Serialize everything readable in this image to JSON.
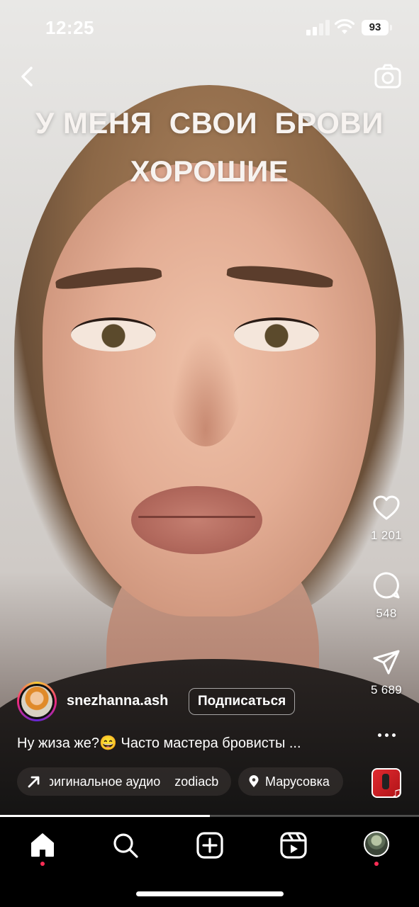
{
  "status_bar": {
    "time": "12:25",
    "battery": "93"
  },
  "overlay_text": {
    "line1": "У МЕНЯ  СВОИ  БРОВИ",
    "line2": "ХОРОШИЕ"
  },
  "actions": {
    "likes": "1 201",
    "comments": "548",
    "shares": "5 689"
  },
  "author": {
    "username": "snezhanna.ash",
    "follow_label": "Подписаться"
  },
  "caption": "Ну жиза же?😄 Часто мастера бровисты ...",
  "audio_chip": {
    "text": "Оригинальное аудио    zodiacb"
  },
  "location_chip": {
    "text": "Марусовка"
  },
  "playback": {
    "progress_fraction": 0.5
  },
  "tabs": [
    "home",
    "search",
    "create",
    "reels",
    "profile"
  ],
  "colors": {
    "accent_dot": "#ff2d55",
    "background": "#000000"
  }
}
